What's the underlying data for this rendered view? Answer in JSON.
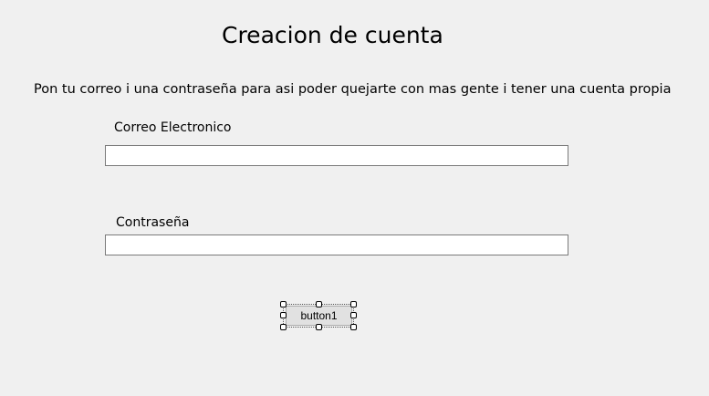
{
  "form": {
    "title": "Creacion de cuenta",
    "description": "Pon tu correo i una contraseña para asi poder quejarte con mas gente i tener una cuenta propia",
    "email_label": "Correo Electronico",
    "email_value": "",
    "password_label": "Contraseña",
    "password_value": "",
    "button_label": "button1"
  }
}
